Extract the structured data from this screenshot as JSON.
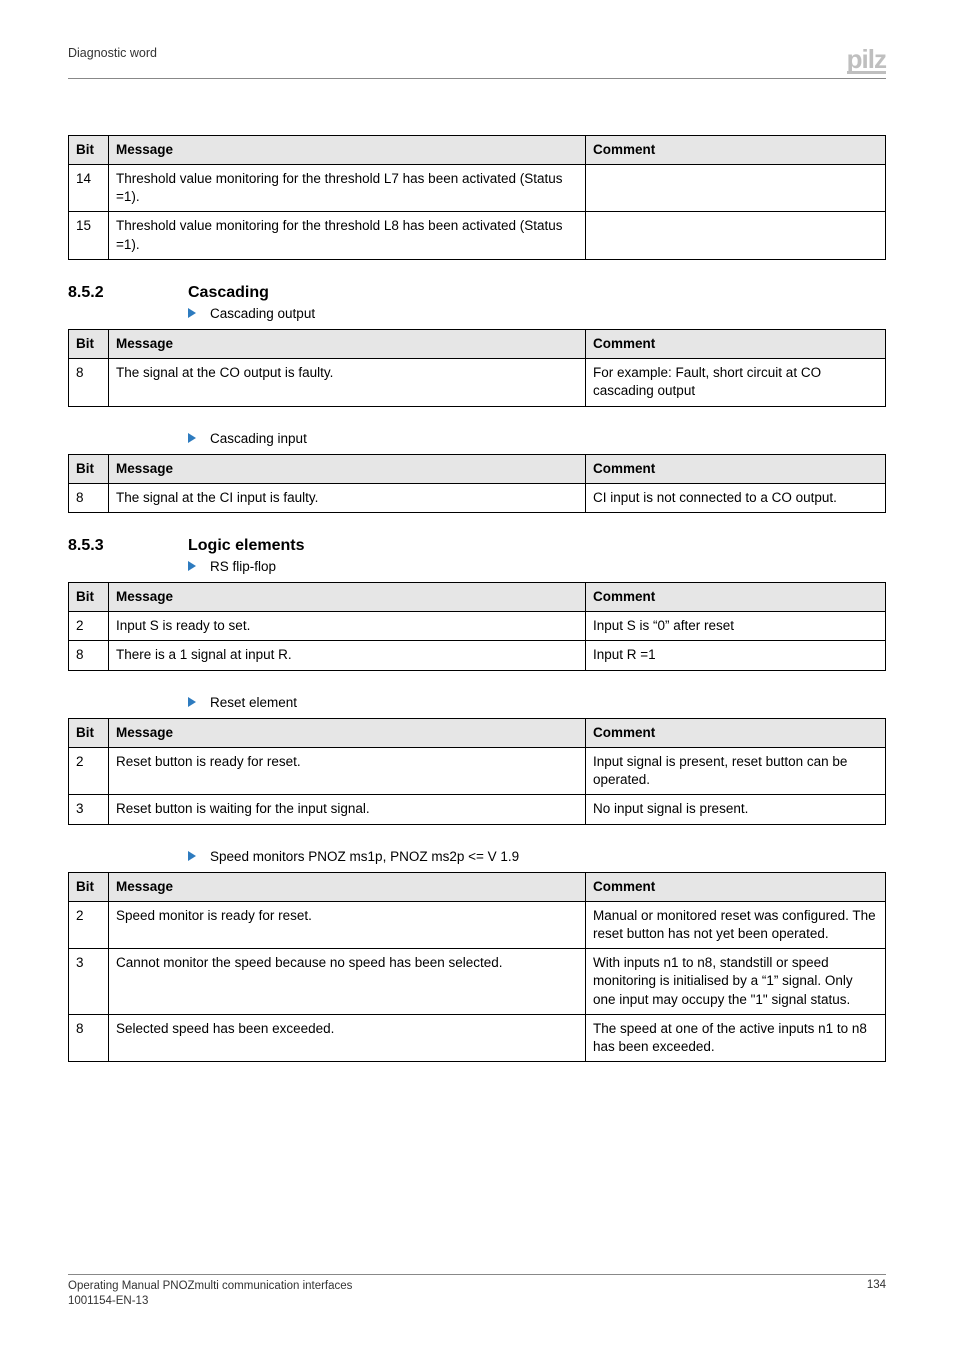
{
  "header": {
    "title": "Diagnostic word",
    "logo": "pilz"
  },
  "table1": {
    "headers": [
      "Bit",
      "Message",
      "Comment"
    ],
    "rows": [
      {
        "bit": "14",
        "message": "Threshold value monitoring for the threshold L7 has been activated (Status =1).",
        "comment": ""
      },
      {
        "bit": "15",
        "message": "Threshold value monitoring for the threshold L8 has been activated (Status =1).",
        "comment": ""
      }
    ]
  },
  "sec852": {
    "num": "8.5.2",
    "title": "Cascading"
  },
  "bullet_co": "Cascading output",
  "table_co": {
    "headers": [
      "Bit",
      "Message",
      "Comment"
    ],
    "rows": [
      {
        "bit": "8",
        "message": "The signal at the CO output is faulty.",
        "comment": "For example: Fault, short circuit at CO cascading output"
      }
    ]
  },
  "bullet_ci": "Cascading input",
  "table_ci": {
    "headers": [
      "Bit",
      "Message",
      "Comment"
    ],
    "rows": [
      {
        "bit": "8",
        "message": "The signal at the CI input is faulty.",
        "comment": "CI input is not connected to a CO output."
      }
    ]
  },
  "sec853": {
    "num": "8.5.3",
    "title": "Logic elements"
  },
  "bullet_rs": "RS flip-flop",
  "table_rs": {
    "headers": [
      "Bit",
      "Message",
      "Comment"
    ],
    "rows": [
      {
        "bit": "2",
        "message": "Input S is ready to set.",
        "comment": "Input S is “0” after reset"
      },
      {
        "bit": "8",
        "message": "There is a 1 signal at input R.",
        "comment": "Input R =1"
      }
    ]
  },
  "bullet_reset": "Reset element",
  "table_reset": {
    "headers": [
      "Bit",
      "Message",
      "Comment"
    ],
    "rows": [
      {
        "bit": "2",
        "message": "Reset button is ready for reset.",
        "comment": "Input signal is present, reset button can be operated."
      },
      {
        "bit": "3",
        "message": "Reset button is waiting for the input signal.",
        "comment": "No input signal is present."
      }
    ]
  },
  "bullet_speed": "Speed monitors PNOZ ms1p, PNOZ ms2p <= V 1.9",
  "table_speed": {
    "headers": [
      "Bit",
      "Message",
      "Comment"
    ],
    "rows": [
      {
        "bit": "2",
        "message": "Speed monitor is ready for reset.",
        "comment": "Manual or monitored reset was configured. The reset button has not yet been operated."
      },
      {
        "bit": "3",
        "message": "Cannot monitor the speed because no speed has been selected.",
        "comment": "With inputs n1 to n8, standstill or speed monitoring is initialised by a “1” signal. Only one input may occupy the \"1\" signal status."
      },
      {
        "bit": "8",
        "message": "Selected speed has been exceeded.",
        "comment": "The speed at one of the active inputs n1 to n8 has been exceeded."
      }
    ]
  },
  "footer": {
    "line1": "Operating Manual PNOZmulti communication interfaces",
    "line2": "1001154-EN-13",
    "page": "134"
  },
  "chart_data": [
    {
      "type": "table",
      "title": "",
      "columns": [
        "Bit",
        "Message",
        "Comment"
      ],
      "rows": [
        [
          "14",
          "Threshold value monitoring for the threshold L7 has been activated (Status =1).",
          ""
        ],
        [
          "15",
          "Threshold value monitoring for the threshold L8 has been activated (Status =1).",
          ""
        ]
      ]
    },
    {
      "type": "table",
      "title": "Cascading output",
      "columns": [
        "Bit",
        "Message",
        "Comment"
      ],
      "rows": [
        [
          "8",
          "The signal at the CO output is faulty.",
          "For example: Fault, short circuit at CO cascading output"
        ]
      ]
    },
    {
      "type": "table",
      "title": "Cascading input",
      "columns": [
        "Bit",
        "Message",
        "Comment"
      ],
      "rows": [
        [
          "8",
          "The signal at the CI input is faulty.",
          "CI input is not connected to a CO output."
        ]
      ]
    },
    {
      "type": "table",
      "title": "RS flip-flop",
      "columns": [
        "Bit",
        "Message",
        "Comment"
      ],
      "rows": [
        [
          "2",
          "Input S is ready to set.",
          "Input S is \"0\" after reset"
        ],
        [
          "8",
          "There is a 1 signal at input R.",
          "Input R =1"
        ]
      ]
    },
    {
      "type": "table",
      "title": "Reset element",
      "columns": [
        "Bit",
        "Message",
        "Comment"
      ],
      "rows": [
        [
          "2",
          "Reset button is ready for reset.",
          "Input signal is present, reset button can be operated."
        ],
        [
          "3",
          "Reset button is waiting for the input signal.",
          "No input signal is present."
        ]
      ]
    },
    {
      "type": "table",
      "title": "Speed monitors PNOZ ms1p, PNOZ ms2p <= V 1.9",
      "columns": [
        "Bit",
        "Message",
        "Comment"
      ],
      "rows": [
        [
          "2",
          "Speed monitor is ready for reset.",
          "Manual or monitored reset was configured. The reset button has not yet been operated."
        ],
        [
          "3",
          "Cannot monitor the speed because no speed has been selected.",
          "With inputs n1 to n8, standstill or speed monitoring is initialised by a \"1\" signal. Only one input may occupy the \"1\" signal status."
        ],
        [
          "8",
          "Selected speed has been exceeded.",
          "The speed at one of the active inputs n1 to n8 has been exceeded."
        ]
      ]
    }
  ]
}
